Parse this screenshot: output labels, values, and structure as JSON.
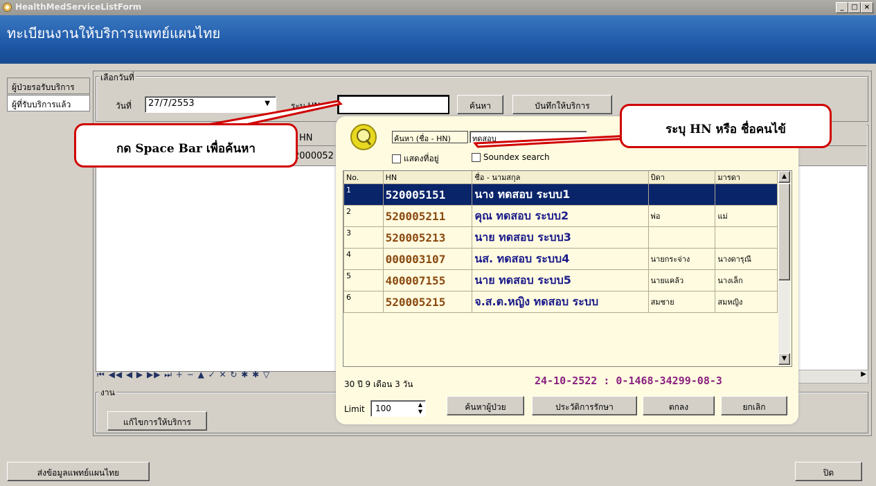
{
  "window": {
    "title": "HealthMedServiceListForm"
  },
  "header": {
    "title": "ทะเบียนงานให้บริการแพทย์แผนไทย"
  },
  "tabs": [
    {
      "label": "ผู้ป่วยรอรับบริการ"
    },
    {
      "label": "ผู้ที่รับบริการแล้ว"
    }
  ],
  "date_group": {
    "legend": "เลือกวันที่",
    "date_label": "วันที่",
    "date_value": "27/7/2553",
    "hn_label": "ระบุ HN",
    "search_button": "ค้นหา",
    "record_button": "บันทึกให้บริการ"
  },
  "back_grid": {
    "col_hn": "HN",
    "hn_partial": "2000052"
  },
  "work_group": {
    "legend": "งาน",
    "edit_button": "แก้ไขการให้บริการ"
  },
  "footer": {
    "send_button": "ส่งข้อมูลแพทย์แผนไทย",
    "close_button": "ปิด"
  },
  "popup": {
    "search_label": "ค้นหา (ชื่อ - HN)",
    "search_value": "ทดสอบ",
    "show_address": "แสดงที่อยู่",
    "soundex": "Soundex search",
    "columns": [
      "No.",
      "HN",
      "ชื่อ - นามสกุล",
      "บิดา",
      "มารดา"
    ],
    "rows": [
      {
        "no": "1",
        "hn": "520005151",
        "name": "นาง ทดสอบ ระบบ1",
        "father": "",
        "mother": ""
      },
      {
        "no": "2",
        "hn": "520005211",
        "name": "คุณ ทดสอบ ระบบ2",
        "father": "พ่อ",
        "mother": "แม่"
      },
      {
        "no": "3",
        "hn": "520005213",
        "name": "นาย ทดสอบ ระบบ3",
        "father": "",
        "mother": ""
      },
      {
        "no": "4",
        "hn": "000003107",
        "name": "นส. ทดสอบ ระบบ4",
        "father": "นายกระจ่าง",
        "mother": "นางดารุณี"
      },
      {
        "no": "5",
        "hn": "400007155",
        "name": "นาย ทดสอบ ระบบ5",
        "father": "นายแคล้ว",
        "mother": "นางเล็ก"
      },
      {
        "no": "6",
        "hn": "520005215",
        "name": "จ.ส.ต.หญิง ทดสอบ ระบบ",
        "father": "สมชาย",
        "mother": "สมหญิง"
      }
    ],
    "age_text": "30 ปี 9 เดือน 3 วัน",
    "birth_info": "24-10-2522 : 0-1468-34299-08-3",
    "limit_label": "Limit",
    "limit_value": "100",
    "buttons": {
      "find_patient": "ค้นหาผู้ป่วย",
      "history": "ประวัติการรักษา",
      "ok": "ตกลง",
      "cancel": "ยกเลิก"
    }
  },
  "callouts": {
    "spacebar": "กด Space Bar เพื่อค้นหา",
    "hn_hint": "ระบุ HN หรือ ชื่อคนไข้"
  }
}
